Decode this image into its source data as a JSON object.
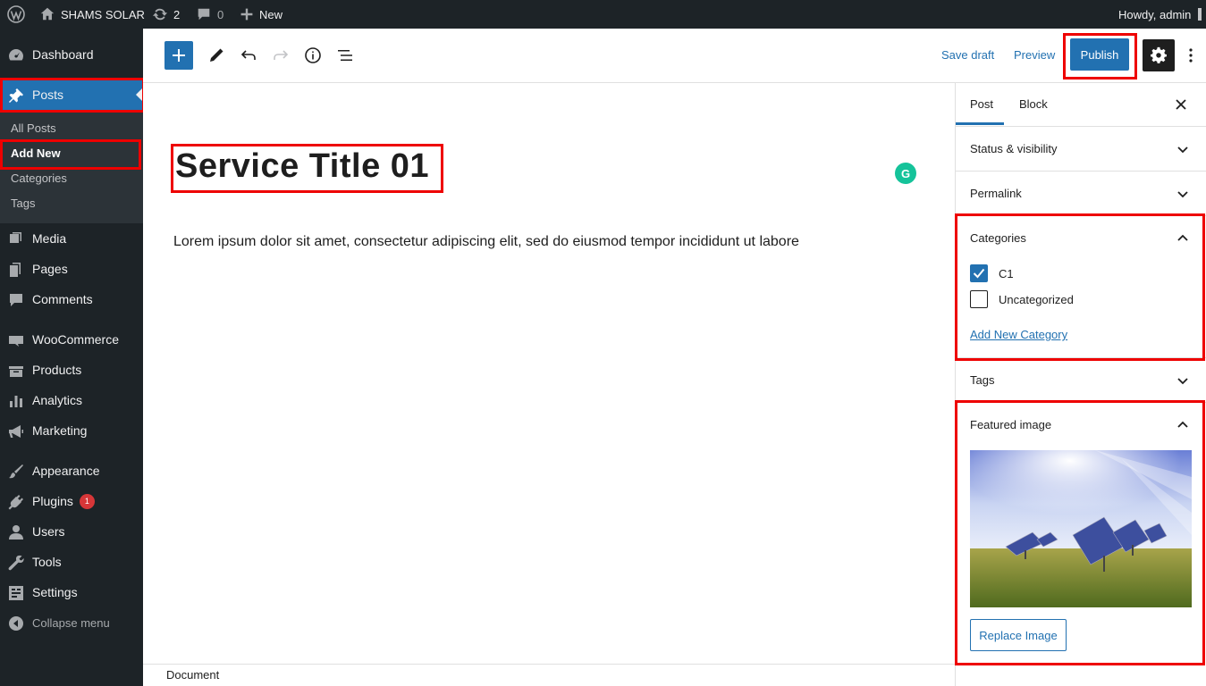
{
  "adminbar": {
    "site_name": "SHAMS SOLAR",
    "updates_count": "2",
    "comments_count": "0",
    "new_label": "New",
    "howdy": "Howdy, admin"
  },
  "sidebar": {
    "items": [
      {
        "label": "Dashboard",
        "icon": "dashboard-icon"
      },
      {
        "label": "Posts",
        "icon": "pin-icon"
      },
      {
        "label": "Media",
        "icon": "media-icon"
      },
      {
        "label": "Pages",
        "icon": "pages-icon"
      },
      {
        "label": "Comments",
        "icon": "comments-icon"
      },
      {
        "label": "WooCommerce",
        "icon": "woocommerce-icon"
      },
      {
        "label": "Products",
        "icon": "products-icon"
      },
      {
        "label": "Analytics",
        "icon": "analytics-icon"
      },
      {
        "label": "Marketing",
        "icon": "megaphone-icon"
      },
      {
        "label": "Appearance",
        "icon": "brush-icon"
      },
      {
        "label": "Plugins",
        "icon": "plugin-icon"
      },
      {
        "label": "Users",
        "icon": "users-icon"
      },
      {
        "label": "Tools",
        "icon": "wrench-icon"
      },
      {
        "label": "Settings",
        "icon": "settings-icon"
      },
      {
        "label": "Collapse menu",
        "icon": "collapse-icon"
      }
    ],
    "plugins_badge": "1",
    "posts_submenu": [
      "All Posts",
      "Add New",
      "Categories",
      "Tags"
    ]
  },
  "toolbar": {
    "save_draft": "Save draft",
    "preview": "Preview",
    "publish": "Publish"
  },
  "editor": {
    "title": "Service Title 01",
    "paragraph": "Lorem ipsum dolor sit amet, consectetur adipiscing elit, sed do eiusmod tempor incididunt ut labore",
    "grammarly_glyph": "G"
  },
  "settings_sidebar": {
    "tabs": [
      "Post",
      "Block"
    ],
    "panels": {
      "status": "Status & visibility",
      "permalink": "Permalink",
      "categories": "Categories",
      "tags": "Tags",
      "featured": "Featured image"
    },
    "categories": [
      {
        "label": "C1",
        "checked": true
      },
      {
        "label": "Uncategorized",
        "checked": false
      }
    ],
    "add_category": "Add New Category",
    "replace_image": "Replace Image"
  },
  "footer": {
    "breadcrumb": "Document"
  },
  "colors": {
    "accent": "#2271b1",
    "admin_bg": "#1d2327",
    "highlight": "#e00000"
  }
}
